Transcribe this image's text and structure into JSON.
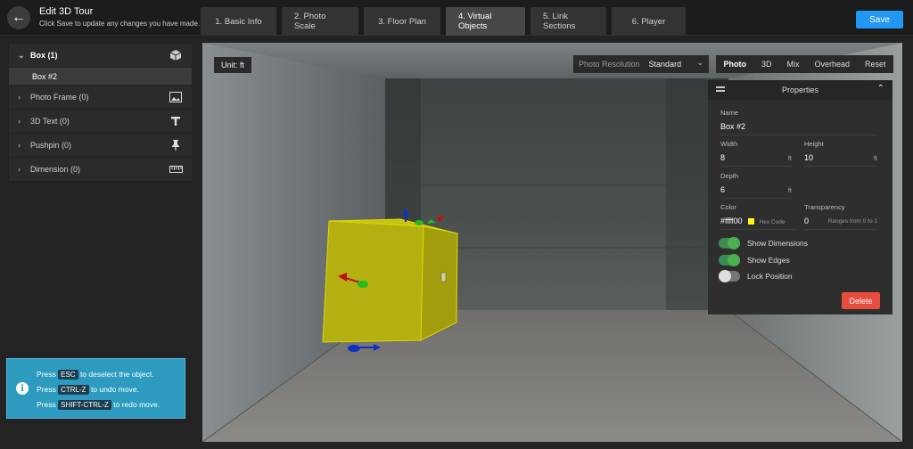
{
  "header": {
    "back_icon": "arrow-left-icon",
    "title": "Edit 3D Tour",
    "subtitle": "Click Save to update any changes you have made.",
    "save_label": "Save",
    "save_color": "#2196f3"
  },
  "tabs": [
    {
      "label": "1. Basic Info"
    },
    {
      "label": "2. Photo Scale"
    },
    {
      "label": "3. Floor Plan"
    },
    {
      "label": "4. Virtual Objects",
      "active": true
    },
    {
      "label": "5. Link Sections"
    },
    {
      "label": "6. Player"
    }
  ],
  "objects": {
    "groups": [
      {
        "label": "Box (1)",
        "expanded": true,
        "icon": "cube-icon"
      },
      {
        "label": "Photo Frame (0)",
        "icon": "image-icon"
      },
      {
        "label": "3D Text (0)",
        "icon": "text-icon"
      },
      {
        "label": "Pushpin (0)",
        "icon": "pushpin-icon"
      },
      {
        "label": "Dimension (0)",
        "icon": "ruler-icon"
      }
    ],
    "selected_item": "Box #2"
  },
  "tip": {
    "press": "Press",
    "esc_key": "ESC",
    "esc_text": "to deselect the object.",
    "undo_key": "CTRL-Z",
    "undo_text": "to undo move.",
    "redo_key": "SHIFT-CTRL-Z",
    "redo_text": "to redo move."
  },
  "viewport": {
    "unit_label": "Unit: ft",
    "resolution_label": "Photo Resolution",
    "resolution_value": "Standard",
    "modes": [
      "Photo",
      "3D",
      "Mix",
      "Overhead",
      "Reset"
    ],
    "active_mode": "Photo"
  },
  "properties": {
    "title": "Properties",
    "name_label": "Name",
    "name_value": "Box #2",
    "width_label": "Width",
    "width_value": "8",
    "height_label": "Height",
    "height_value": "10",
    "depth_label": "Depth",
    "depth_value": "6",
    "unit": "ft",
    "color_label": "Color",
    "color_value": "#ffff00",
    "hex_hint": "Hex Code",
    "transparency_label": "Transparency",
    "transparency_value": "0",
    "transparency_hint": "Ranges from 0 to 1",
    "toggles": [
      {
        "label": "Show Dimensions",
        "on": true
      },
      {
        "label": "Show Edges",
        "on": true
      },
      {
        "label": "Lock Position",
        "on": false
      }
    ],
    "delete_label": "Delete",
    "delete_color": "#e74c3c"
  }
}
